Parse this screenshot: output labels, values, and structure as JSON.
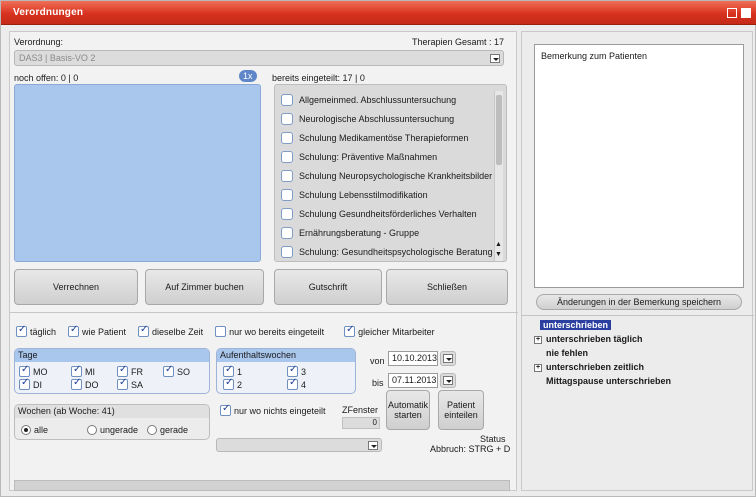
{
  "window": {
    "title": "Verordnungen"
  },
  "header": {
    "verordnung_label": "Verordnung:",
    "therapien_label": "Therapien Gesamt : 17",
    "verordnung_value": "DAS3 | Basis-VO 2"
  },
  "left": {
    "noch_offen": "noch offen: 0 | 0",
    "badge": "1x"
  },
  "right": {
    "bereits_label": "bereits eingeteilt: 17 | 0",
    "items": [
      "Allgemeinmed. Abschlussuntersuchung",
      "Neurologische Abschlussuntersuchung",
      "Schulung Medikamentöse Therapieformen",
      "Schulung: Präventive Maßnahmen",
      "Schulung Neuropsychologische Krankheitsbilder",
      "Schulung Lebensstilmodifikation",
      "Schulung Gesundheitsförderliches Verhalten",
      "Ernährungsberatung - Gruppe",
      "Schulung: Gesundheitspsychologische Beratung"
    ]
  },
  "buttons": {
    "verrechnen": "Verrechnen",
    "zimmer": "Auf Zimmer buchen",
    "gutschrift": "Gutschrift",
    "schliessen": "Schließen",
    "automatik": "Automatik starten",
    "patient": "Patient einteilen",
    "save_note": "Änderungen in der Bemerkung speichern"
  },
  "options": {
    "taeglich": "täglich",
    "wie_patient": "wie Patient",
    "dieselbe_zeit": "dieselbe Zeit",
    "nur_bereits": "nur wo bereits eingeteilt",
    "gleicher": "gleicher Mitarbeiter"
  },
  "days": {
    "title": "Tage",
    "mo": "MO",
    "di": "DI",
    "mi": "MI",
    "do": "DO",
    "fr": "FR",
    "sa": "SA",
    "so": "SO"
  },
  "wochen": {
    "title": "Aufenthaltswochen",
    "w1": "1",
    "w2": "2",
    "w3": "3",
    "w4": "4"
  },
  "wochen2": {
    "title": "Wochen (ab Woche: 41)",
    "alle": "alle",
    "ungerade": "ungerade",
    "gerade": "gerade"
  },
  "dates": {
    "von_label": "von",
    "von": "10.10.2013",
    "bis_label": "bis",
    "bis": "07.11.2013"
  },
  "misc": {
    "nur_nichts": "nur wo nichts eingeteilt",
    "zfenster": "ZFenster",
    "zfenster_value": "0",
    "status": "Status",
    "abbruch": "Abbruch: STRG + D"
  },
  "notes": {
    "label": "Bemerkung zum Patienten"
  },
  "tree": {
    "items": [
      "unterschrieben",
      "unterschrieben täglich",
      "nie fehlen",
      "unterschrieben zeitlich",
      "Mittagspause unterschrieben"
    ]
  }
}
